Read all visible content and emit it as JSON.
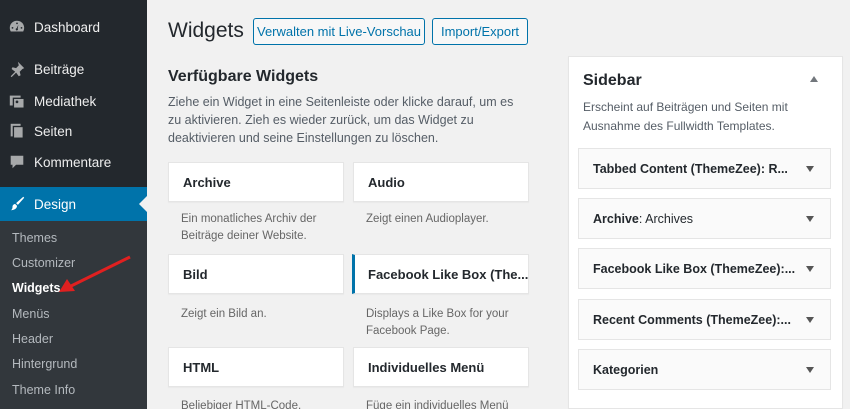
{
  "admin_menu": {
    "items": [
      {
        "label": "Dashboard",
        "icon": "dashboard-icon"
      },
      {
        "label": "Beiträge",
        "icon": "pin-icon"
      },
      {
        "label": "Mediathek",
        "icon": "media-icon"
      },
      {
        "label": "Seiten",
        "icon": "pages-icon"
      },
      {
        "label": "Kommentare",
        "icon": "comments-icon"
      },
      {
        "label": "Design",
        "icon": "brush-icon"
      }
    ],
    "submenu": [
      "Themes",
      "Customizer",
      "Widgets",
      "Menüs",
      "Header",
      "Hintergrund",
      "Theme Info"
    ]
  },
  "header": {
    "title": "Widgets",
    "manage_button": "Verwalten mit Live-Vorschau",
    "import_button": "Import/Export"
  },
  "available": {
    "heading": "Verfügbare Widgets",
    "description": "Ziehe ein Widget in eine Seitenleiste oder klicke darauf, um es zu aktivieren. Zieh es wieder zurück, um das Widget zu deaktivieren und seine Einstellungen zu löschen.",
    "widgets": [
      {
        "title": "Archive",
        "desc": "Ein monatliches Archiv der Beiträge deiner Website."
      },
      {
        "title": "Audio",
        "desc": "Zeigt einen Audioplayer."
      },
      {
        "title": "Bild",
        "desc": "Zeigt ein Bild an."
      },
      {
        "title": "Facebook Like Box (The...",
        "desc": "Displays a Like Box for your Facebook Page."
      },
      {
        "title": "HTML",
        "desc": "Beliebiger HTML-Code."
      },
      {
        "title": "Individuelles Menü",
        "desc": "Füge ein individuelles Menü"
      }
    ]
  },
  "sidebar": {
    "title": "Sidebar",
    "description": "Erscheint auf Beiträgen und Seiten mit Ausnahme des Fullwidth Templates.",
    "widgets": [
      {
        "title": "Tabbed Content (ThemeZee): R..."
      },
      {
        "title": "Archive",
        "subtitle": ": Archives"
      },
      {
        "title": "Facebook Like Box (ThemeZee):..."
      },
      {
        "title": "Recent Comments (ThemeZee):..."
      },
      {
        "title": "Kategorien"
      }
    ]
  },
  "colors": {
    "accent": "#0073aa",
    "menu_bg": "#23282d",
    "submenu_bg": "#32373c",
    "annotation": "#e02020"
  }
}
